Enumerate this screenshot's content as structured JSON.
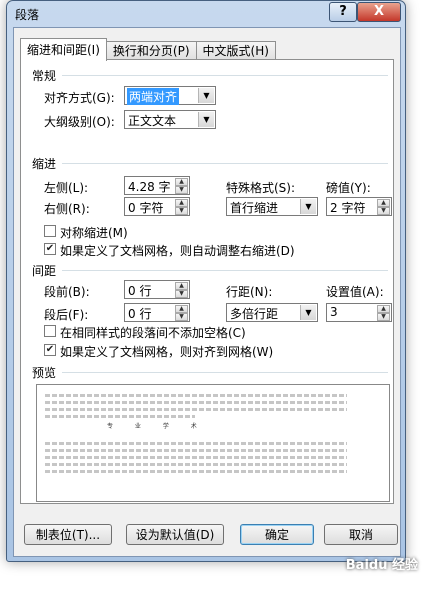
{
  "window": {
    "title": "段落",
    "help_label": "?",
    "close_label": "X"
  },
  "tabs": [
    {
      "label": "缩进和间距(I)",
      "active": true
    },
    {
      "label": "换行和分页(P)",
      "active": false
    },
    {
      "label": "中文版式(H)",
      "active": false
    }
  ],
  "general": {
    "group_label": "常规",
    "alignment_label": "对齐方式(G):",
    "alignment_value": "两端对齐",
    "outline_label": "大纲级别(O):",
    "outline_value": "正文文本"
  },
  "indent": {
    "group_label": "缩进",
    "left_label": "左侧(L):",
    "left_value": "4.28 字",
    "right_label": "右侧(R):",
    "right_value": "0 字符",
    "special_label": "特殊格式(S):",
    "special_value": "首行缩进",
    "by_label": "磅值(Y):",
    "by_value": "2 字符",
    "mirror_label": "对称缩进(M)",
    "mirror_checked": false,
    "auto_adjust_label": "如果定义了文档网格，则自动调整右缩进(D)",
    "auto_adjust_checked": true
  },
  "spacing": {
    "group_label": "间距",
    "before_label": "段前(B):",
    "before_value": "0 行",
    "after_label": "段后(F):",
    "after_value": "0 行",
    "line_label": "行距(N):",
    "line_value": "多倍行距",
    "at_label": "设置值(A):",
    "at_value": "3",
    "no_space_label": "在相同样式的段落间不添加空格(C)",
    "no_space_checked": false,
    "snap_grid_label": "如果定义了文档网格，则对齐到网格(W)",
    "snap_grid_checked": true
  },
  "preview": {
    "group_label": "预览",
    "sample_text": "专 业 学 术"
  },
  "buttons": {
    "tabs_label": "制表位(T)...",
    "default_label": "设为默认值(D)",
    "ok_label": "确定",
    "cancel_label": "取消"
  },
  "watermark": "Baidu 经验"
}
